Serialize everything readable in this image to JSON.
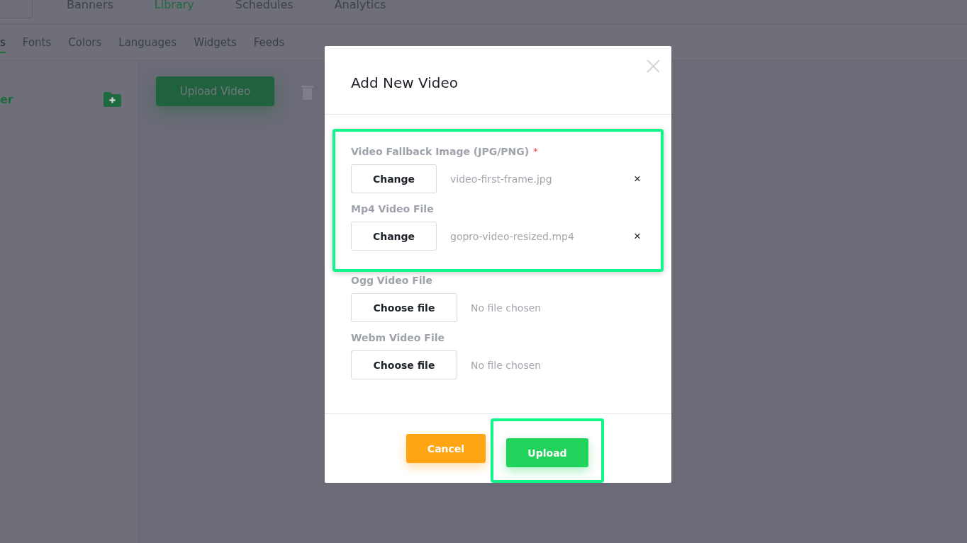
{
  "top_nav": [
    {
      "label": "Banners",
      "selected": false
    },
    {
      "label": "Library",
      "selected": true
    },
    {
      "label": "Schedules",
      "selected": false
    },
    {
      "label": "Analytics",
      "selected": false
    }
  ],
  "sub_nav": [
    {
      "label": "s",
      "selected": true
    },
    {
      "label": "Fonts",
      "selected": false
    },
    {
      "label": "Colors",
      "selected": false
    },
    {
      "label": "Languages",
      "selected": false
    },
    {
      "label": "Widgets",
      "selected": false
    },
    {
      "label": "Feeds",
      "selected": false
    }
  ],
  "sidebar": {
    "folder_label": "er"
  },
  "main": {
    "upload_button": "Upload Video"
  },
  "modal": {
    "title": "Add New Video",
    "field_groups": [
      {
        "highlighted": true,
        "fields": [
          {
            "kind": "selected",
            "label": "Video Fallback Image (JPG/PNG)",
            "required_mark": "*",
            "button": "Change",
            "file_name": "video-first-frame.jpg",
            "remove": "×"
          },
          {
            "kind": "selected",
            "label": "Mp4 Video File",
            "button": "Change",
            "file_name": "gopro-video-resized.mp4",
            "remove": "×"
          }
        ]
      },
      {
        "highlighted": false,
        "fields": [
          {
            "kind": "empty",
            "label": "Ogg Video File",
            "button": "Choose file",
            "file_name": "No file chosen"
          },
          {
            "kind": "empty",
            "label": "Webm Video File",
            "button": "Choose file",
            "file_name": "No file chosen"
          }
        ]
      }
    ],
    "buttons": [
      {
        "kind": "cancel",
        "label": "Cancel",
        "highlighted": false
      },
      {
        "kind": "primary",
        "label": "Upload",
        "highlighted": true
      }
    ]
  }
}
